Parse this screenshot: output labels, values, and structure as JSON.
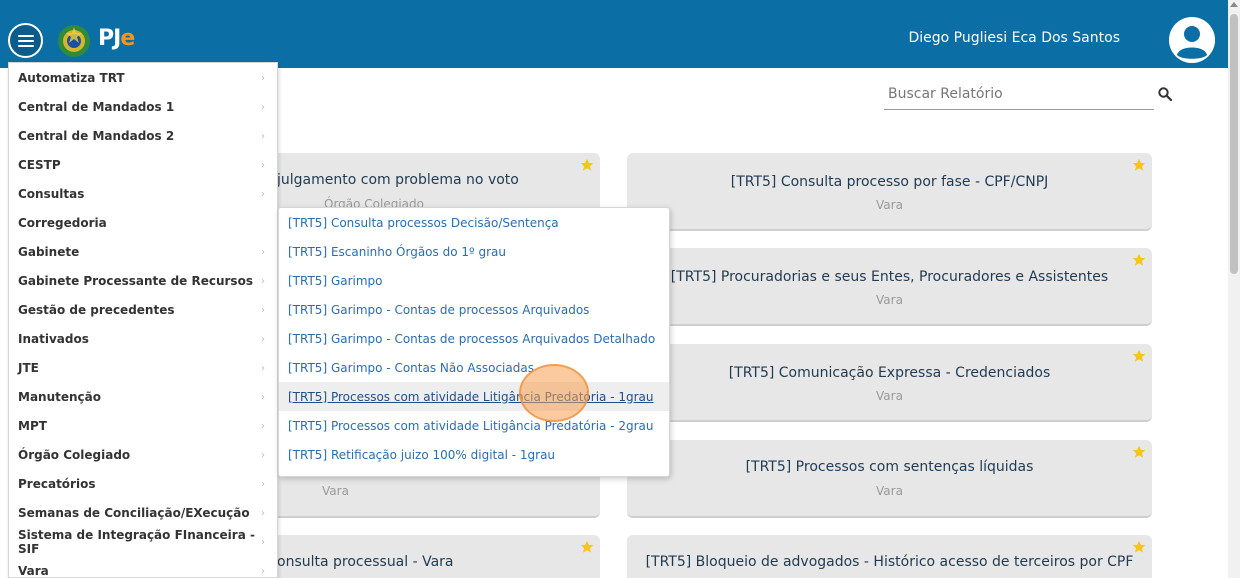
{
  "header": {
    "app_name": "PJ",
    "app_name_accent": "e",
    "user_name": "Diego Pugliesi Eca Dos Santos"
  },
  "search": {
    "placeholder": "Buscar Relatório"
  },
  "side_menu": {
    "items": [
      {
        "label": "Automatiza TRT"
      },
      {
        "label": "Central de Mandados 1"
      },
      {
        "label": "Central de Mandados 2"
      },
      {
        "label": "CESTP"
      },
      {
        "label": "Consultas"
      },
      {
        "label": "Corregedoria"
      },
      {
        "label": "Gabinete"
      },
      {
        "label": "Gabinete Processante de Recursos"
      },
      {
        "label": "Gestão de precedentes"
      },
      {
        "label": "Inativados"
      },
      {
        "label": "JTE"
      },
      {
        "label": "Manutenção"
      },
      {
        "label": "MPT"
      },
      {
        "label": "Órgão Colegiado"
      },
      {
        "label": "Precatórios"
      },
      {
        "label": "Semanas de Conciliação/EXecução"
      },
      {
        "label": "Sistema de Integração FInanceira - SIF"
      },
      {
        "label": "Vara"
      }
    ]
  },
  "submenu": {
    "items": [
      {
        "label": "[TRT5] Consulta processos Decisão/Sentença"
      },
      {
        "label": "[TRT5] Escaninho Órgãos do 1º grau"
      },
      {
        "label": "[TRT5] Garimpo"
      },
      {
        "label": "[TRT5] Garimpo - Contas de processos Arquivados"
      },
      {
        "label": "[TRT5] Garimpo - Contas de processos Arquivados Detalhado"
      },
      {
        "label": "[TRT5] Garimpo - Contas Não Associadas"
      },
      {
        "label": "[TRT5] Processos com atividade Litigância Predatória - 1grau"
      },
      {
        "label": "[TRT5] Processos com atividade Litigância Predatória - 2grau"
      },
      {
        "label": "[TRT5] Retificação juizo 100% digital - 1grau"
      }
    ]
  },
  "cards": {
    "left": [
      {
        "title": "julgamento com problema no voto",
        "subtitle": "Órgão Colegiado"
      },
      {
        "title": "",
        "subtitle": "Vara"
      },
      {
        "title": "onsulta processual - Vara",
        "subtitle": ""
      }
    ],
    "right": [
      {
        "title": "[TRT5] Consulta processo por fase - CPF/CNPJ",
        "subtitle": "Vara"
      },
      {
        "title": "[TRT5] Procuradorias e seus Entes, Procuradores e Assistentes",
        "subtitle": "Vara"
      },
      {
        "title": "[TRT5] Comunicação Expressa - Credenciados",
        "subtitle": "Vara"
      },
      {
        "title": "[TRT5] Processos com sentenças líquidas",
        "subtitle": "Vara"
      },
      {
        "title": "[TRT5] Bloqueio de advogados - Histórico acesso de terceiros por CPF",
        "subtitle": ""
      }
    ]
  },
  "icons": {
    "menu": "hamburger-menu-icon",
    "search": "search-icon",
    "star": "star-icon",
    "chevron": "chevron-right-icon",
    "avatar": "user-avatar-icon"
  },
  "colors": {
    "header": "#0b6fa6",
    "star": "#f5c518",
    "link": "#2a6db5",
    "accent": "#f7941d"
  }
}
